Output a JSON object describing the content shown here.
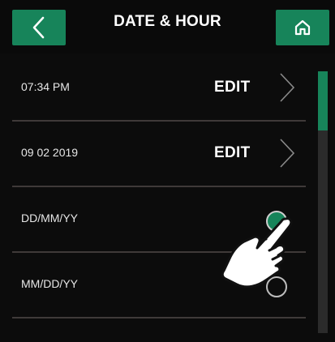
{
  "header": {
    "title": "DATE & HOUR",
    "back_icon": "chevron-left-icon",
    "home_icon": "home-icon"
  },
  "rows": [
    {
      "label": "07:34 PM",
      "action": "EDIT",
      "icon": "chevron-right-icon"
    },
    {
      "label": "09 02 2019",
      "action": "EDIT",
      "icon": "chevron-right-icon"
    },
    {
      "label": "DD/MM/YY",
      "selected": true
    },
    {
      "label": "MM/DD/YY",
      "selected": false
    }
  ],
  "scrollbar": {
    "position": 0.0
  },
  "colors": {
    "accent": "#17845a",
    "background": "#0c0c0c",
    "separator": "#3f3a39",
    "text": "#ffffff"
  },
  "overlay": {
    "icon": "pointing-hand-icon"
  }
}
